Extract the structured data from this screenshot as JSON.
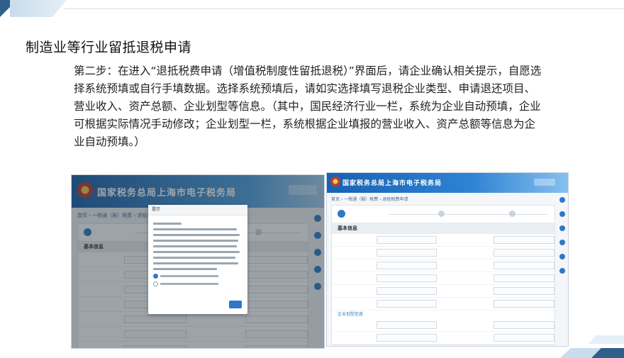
{
  "slide": {
    "title": "制造业等行业留抵退税申请",
    "body": "第二步：在进入“退抵税费申请（增值税制度性留抵退税）”界面后，请企业确认相关提示，自愿选择系统预填或自行手填数据。选择系统预填后，请如实选择填写退税企业类型、申请退还项目、营业收入、资产总额、企业划型等信息。（其中，国民经济行业一栏，系统为企业自动预填，企业可根据实际情况手动修改；企业划型一栏，系统根据企业填报的营业收入、资产总额等信息为企业自动预填。）"
  },
  "screenshot_left": {
    "header_title": "国家税务总局上海市电子税务局",
    "breadcrumb": "首页 › 一税通（报）税费 › 退抵税费申请",
    "section": "基本信息",
    "dialog_title": "提示"
  },
  "screenshot_right": {
    "header_title": "国家税务总局上海市电子税务局",
    "breadcrumb": "首页 › 一税通（报）税费 › 退抵税费申请",
    "section": "基本信息",
    "link": "企业划型信息"
  },
  "colors": {
    "accent": "#2f5f8a",
    "portal_blue": "#1a5fa8",
    "button_blue": "#2e78c7"
  }
}
